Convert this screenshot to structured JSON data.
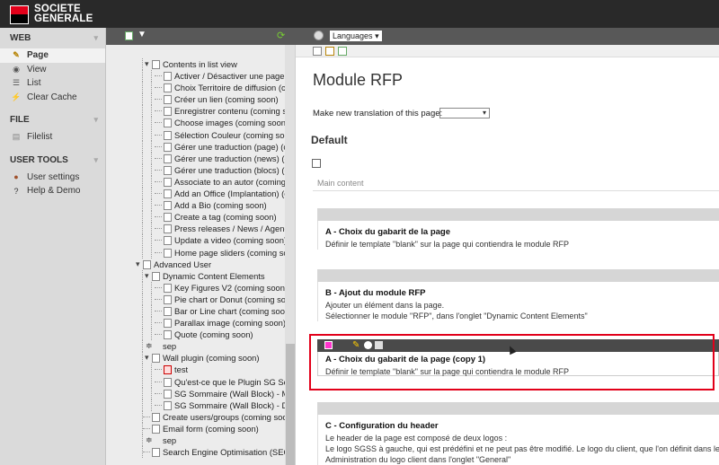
{
  "brand": {
    "line1": "SOCIETE",
    "line2": "GENERALE",
    "red": "#e2001a"
  },
  "module_menu": {
    "web": {
      "title": "WEB",
      "items": [
        {
          "label": "Page",
          "icon": "pencil-page-icon",
          "active": true
        },
        {
          "label": "View",
          "icon": "eye-icon"
        },
        {
          "label": "List",
          "icon": "list-icon"
        },
        {
          "label": "Clear Cache",
          "icon": "lightning-icon"
        }
      ]
    },
    "file": {
      "title": "FILE",
      "items": [
        {
          "label": "Filelist",
          "icon": "folder-icon"
        }
      ]
    },
    "user_tools": {
      "title": "USER TOOLS",
      "items": [
        {
          "label": "User settings",
          "icon": "user-icon"
        },
        {
          "label": "Help & Demo",
          "icon": "help-icon"
        }
      ]
    }
  },
  "tree": {
    "nodes": [
      {
        "label": "Contents in list view",
        "depth": 1,
        "expanded": true
      },
      {
        "label": "Activer / Désactiver une page (",
        "depth": 2
      },
      {
        "label": "Choix Territoire de diffusion (cc",
        "depth": 2
      },
      {
        "label": "Créer un lien (coming soon)",
        "depth": 2
      },
      {
        "label": "Enregistrer contenu (coming sc",
        "depth": 2
      },
      {
        "label": "Choose images (coming soon)",
        "depth": 2
      },
      {
        "label": "Sélection Couleur (coming soon",
        "depth": 2
      },
      {
        "label": "Gérer une traduction (page) (c",
        "depth": 2
      },
      {
        "label": "Gérer une traduction (news) (c",
        "depth": 2
      },
      {
        "label": "Gérer une traduction (blocs) (c",
        "depth": 2
      },
      {
        "label": "Associate to an autor (coming",
        "depth": 2
      },
      {
        "label": "Add an Office (Implantation) (c",
        "depth": 2
      },
      {
        "label": "Add a Bio (coming soon)",
        "depth": 2
      },
      {
        "label": "Create a tag (coming soon)",
        "depth": 2
      },
      {
        "label": "Press releases / News / Agend",
        "depth": 2
      },
      {
        "label": "Update a video (coming soon)",
        "depth": 2
      },
      {
        "label": "Home page sliders (coming so",
        "depth": 2
      },
      {
        "label": "Advanced User",
        "depth": 0,
        "expanded": true
      },
      {
        "label": "Dynamic Content Elements",
        "depth": 1,
        "expanded": true
      },
      {
        "label": "Key Figures V2 (coming soon)",
        "depth": 2
      },
      {
        "label": "Pie chart or Donut (coming soc",
        "depth": 2
      },
      {
        "label": "Bar or Line chart (coming soo",
        "depth": 2
      },
      {
        "label": "Parallax image (coming soon)",
        "depth": 2
      },
      {
        "label": "Quote (coming soon)",
        "depth": 2
      },
      {
        "label": "sep",
        "depth": 1,
        "separator": true
      },
      {
        "label": "Wall plugin (coming soon)",
        "depth": 1,
        "expanded": true
      },
      {
        "label": "test",
        "depth": 2,
        "red": true
      },
      {
        "label": "Qu'est-ce que le Plugin SG Sor",
        "depth": 2
      },
      {
        "label": "SG Sommaire (Wall Block) - M",
        "depth": 2
      },
      {
        "label": "SG Sommaire (Wall Block) - D",
        "depth": 2
      },
      {
        "label": "Create users/groups (coming soo",
        "depth": 1
      },
      {
        "label": "Email form (coming soon)",
        "depth": 1
      },
      {
        "label": "sep",
        "depth": 1,
        "separator": true
      },
      {
        "label": "Search Engine Optimisation (SEO",
        "depth": 1
      }
    ]
  },
  "content_header": {
    "languages_label": "Languages"
  },
  "page": {
    "title": "Module RFP",
    "translate_label": "Make new translation of this page:",
    "section": "Default",
    "column_label": "Main content",
    "blocks": [
      {
        "title": "A - Choix du gabarit de la page",
        "lines": [
          "Définir le template \"blank\" sur la page qui contiendra le module RFP"
        ]
      },
      {
        "title": "B - Ajout du module RFP",
        "lines": [
          "Ajouter un élément dans la page.",
          "Sélectionner le module \"RFP\", dans l'onglet \"Dynamic Content Elements\""
        ]
      },
      {
        "title": "A - Choix du gabarit de la page (copy 1)",
        "lines": [
          "Définir le template \"blank\" sur la page qui contiendra le module RFP"
        ]
      },
      {
        "title": "C - Configuration du header",
        "lines": [
          "Le header de la page est composé de deux logos :",
          "Le logo SGSS à gauche, qui est prédéfini et ne peut pas être modifié. Le logo du client, que l'on définit dans le",
          "Administration du logo client dans l'onglet \"General\""
        ]
      }
    ]
  }
}
